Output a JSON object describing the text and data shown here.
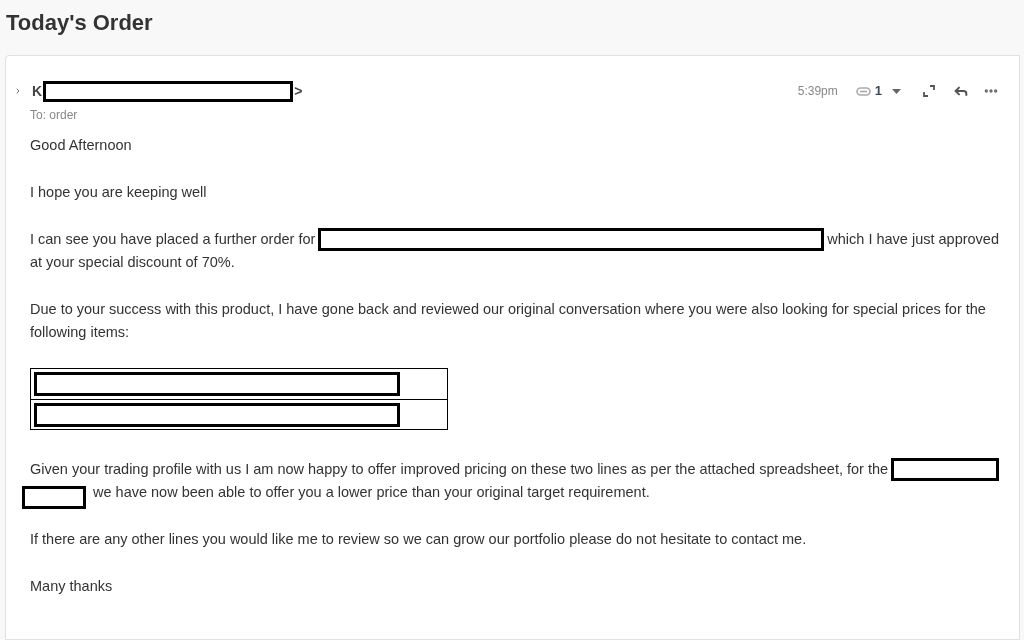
{
  "page_title": "Today's Order",
  "message": {
    "sender": [
      {
        "kind": "text",
        "text": "K"
      },
      {
        "kind": "redaction"
      },
      {
        "kind": "text",
        "text": ">"
      }
    ],
    "recipient": "To: order",
    "time": "5:39pm",
    "attachment_count": "1",
    "body": [
      {
        "kind": "paragraph",
        "lines": [
          [
            {
              "kind": "text",
              "text": "Good Afternoon"
            }
          ]
        ]
      },
      {
        "kind": "paragraph",
        "lines": [
          [
            {
              "kind": "text",
              "text": "I hope you are keeping well"
            }
          ]
        ]
      },
      {
        "kind": "paragraph",
        "lines": [
          [
            {
              "kind": "text",
              "text": "I can see you have placed a further order for"
            },
            {
              "kind": "redaction"
            },
            {
              "kind": "text",
              "text": "which I have just approved"
            }
          ],
          [
            {
              "kind": "text",
              "text": "at your special discount of 70%."
            }
          ]
        ]
      },
      {
        "kind": "paragraph",
        "lines": [
          [
            {
              "kind": "text",
              "text": "Due to your success with this product, I have gone back and reviewed our original conversation where you were also looking for special prices for the following items:"
            }
          ]
        ]
      },
      {
        "kind": "table",
        "rows": [
          {
            "kind": "redaction"
          },
          {
            "kind": "redaction"
          }
        ]
      },
      {
        "kind": "paragraph",
        "lines": [
          [
            {
              "kind": "text",
              "text": "Given your trading profile with us I am now happy to offer improved pricing on these two lines as per the attached spreadsheet, for the"
            },
            {
              "kind": "redaction"
            }
          ],
          [
            {
              "kind": "redaction"
            },
            {
              "kind": "text",
              "text": "we have now been able to offer you a lower price than your original target requirement."
            }
          ]
        ]
      },
      {
        "kind": "paragraph",
        "lines": [
          [
            {
              "kind": "text",
              "text": "If there are any other lines you would like me to review so we can grow our portfolio please do not hesitate to contact me."
            }
          ]
        ]
      },
      {
        "kind": "paragraph",
        "lines": [
          [
            {
              "kind": "text",
              "text": "Many thanks"
            }
          ]
        ]
      }
    ]
  }
}
